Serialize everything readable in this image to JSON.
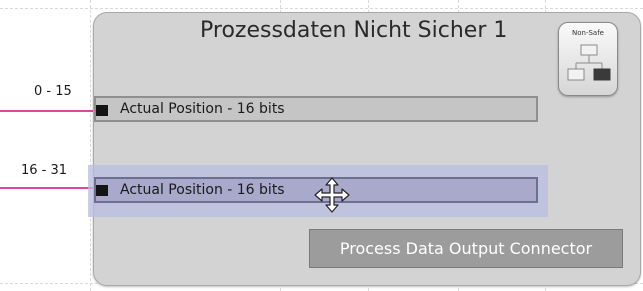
{
  "module": {
    "title": "Prozessdaten Nicht Sicher 1",
    "safety_icon_caption": "Non-Safe",
    "rows": [
      {
        "bit_range": "0 - 15",
        "label": "Actual Position - 16 bits",
        "selected": false
      },
      {
        "bit_range": "16 - 31",
        "label": "Actual Position - 16 bits",
        "selected": true
      }
    ],
    "connector_button_label": "Process Data Output Connector"
  },
  "colors": {
    "wire": "#e0469c",
    "module_background": "#d3d3d3",
    "selection_highlight": "#b9bee1",
    "button_background": "#9c9c9c"
  },
  "icons": [
    "non-safe-network-icon",
    "move-cursor-icon"
  ]
}
